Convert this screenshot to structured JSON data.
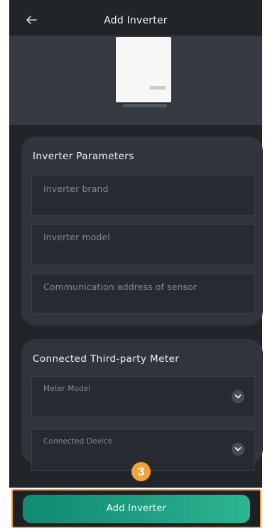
{
  "header": {
    "title": "Add Inverter",
    "back_icon": "arrow-left-icon"
  },
  "inverter_parameters": {
    "title": "Inverter Parameters",
    "fields": [
      {
        "placeholder": "Inverter brand",
        "value": ""
      },
      {
        "placeholder": "Inverter model",
        "value": ""
      },
      {
        "placeholder": "Communication address of sensor",
        "value": ""
      }
    ]
  },
  "meter": {
    "title": "Connected Third-party Meter",
    "selects": [
      {
        "placeholder": "Meter Model",
        "value": "",
        "icon": "chevron-down-icon"
      },
      {
        "placeholder": "Connected Device",
        "value": "",
        "icon": "chevron-down-icon"
      }
    ]
  },
  "footer": {
    "button_label": "Add Inverter",
    "step_badge": "3"
  },
  "colors": {
    "background": "#212529",
    "card": "#30353c",
    "accent_start": "#0f8b6f",
    "accent_end": "#2cb592",
    "highlight": "#f0a43a"
  }
}
